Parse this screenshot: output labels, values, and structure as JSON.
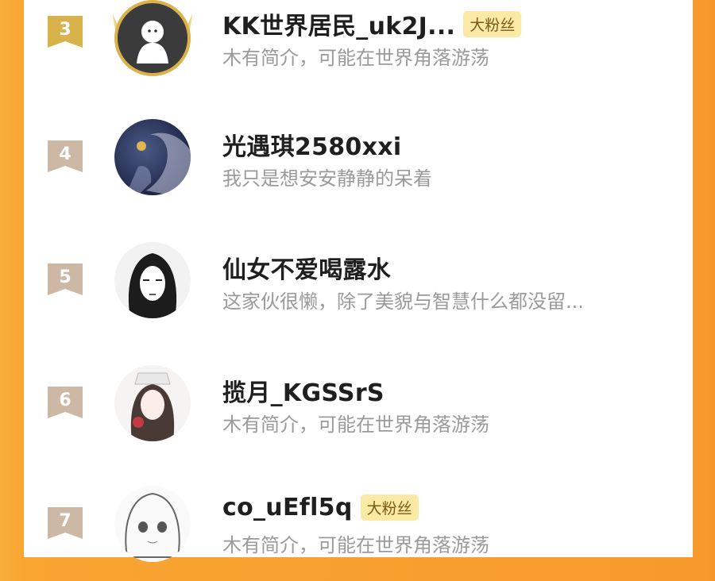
{
  "fans": [
    {
      "rank": "3",
      "name": "KK世界居民_uk2J...",
      "badge": "大粉丝",
      "bio": "木有简介，可能在世界角落游荡"
    },
    {
      "rank": "4",
      "name": "光遇琪2580xxi",
      "badge": "",
      "bio": "我只是想安安静静的呆着"
    },
    {
      "rank": "5",
      "name": "仙女不爱喝露水",
      "badge": "",
      "bio": "这家伙很懒，除了美貌与智慧什么都没留..."
    },
    {
      "rank": "6",
      "name": "揽月_KGSSrS",
      "badge": "",
      "bio": "木有简介，可能在世界角落游荡"
    },
    {
      "rank": "7",
      "name": "co_uEfl5q",
      "badge": "大粉丝",
      "bio": "木有简介，可能在世界角落游荡"
    }
  ],
  "colors": {
    "background": "#f8a432",
    "gold_rank": "#d8b24b",
    "rank_flag": "#cdb8a6",
    "badge_bg": "#fbe9a6"
  }
}
